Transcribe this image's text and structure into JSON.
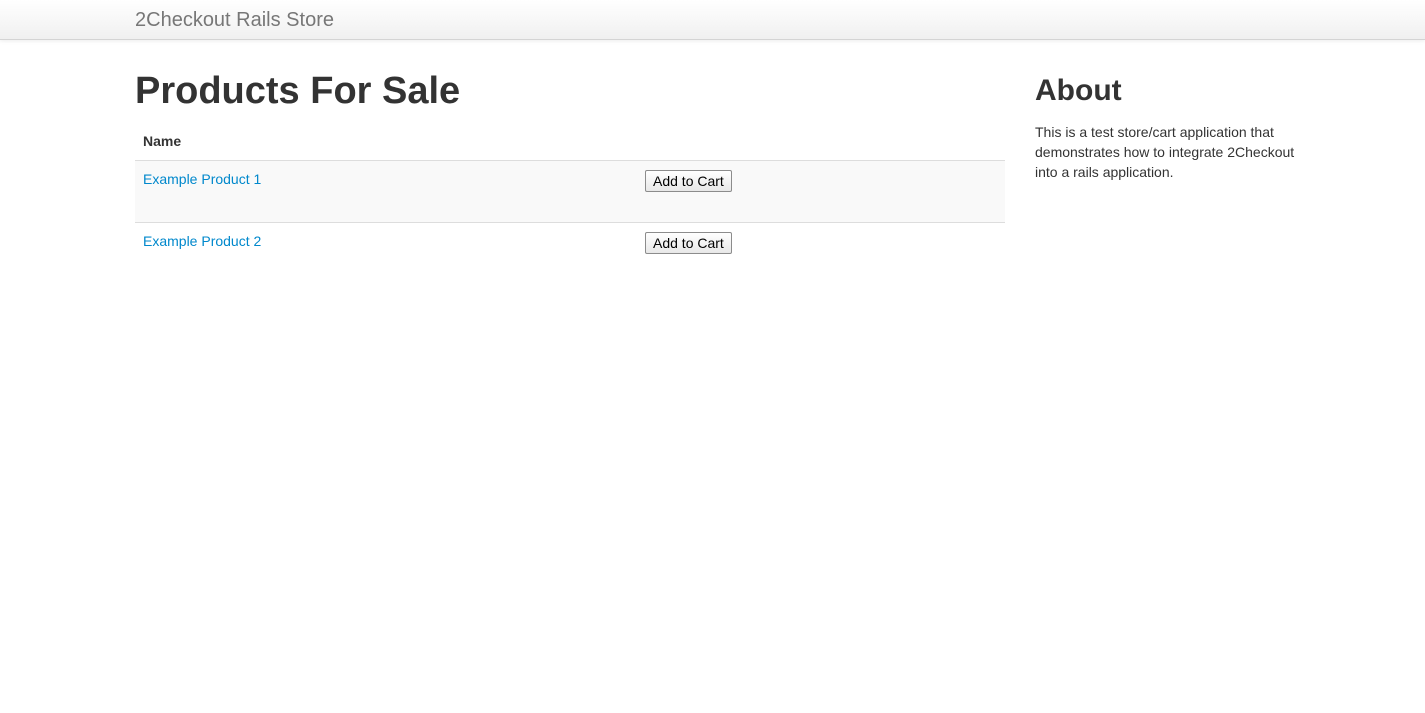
{
  "navbar": {
    "brand": "2Checkout Rails Store"
  },
  "main": {
    "title": "Products For Sale",
    "table": {
      "header_name": "Name",
      "rows": [
        {
          "name": "Example Product 1",
          "button": "Add to Cart"
        },
        {
          "name": "Example Product 2",
          "button": "Add to Cart"
        }
      ]
    }
  },
  "sidebar": {
    "title": "About",
    "text": "This is a test store/cart application that demonstrates how to integrate 2Checkout into a rails application."
  },
  "colors": {
    "link": "#0088cc",
    "text": "#333333",
    "brand": "#777777"
  }
}
